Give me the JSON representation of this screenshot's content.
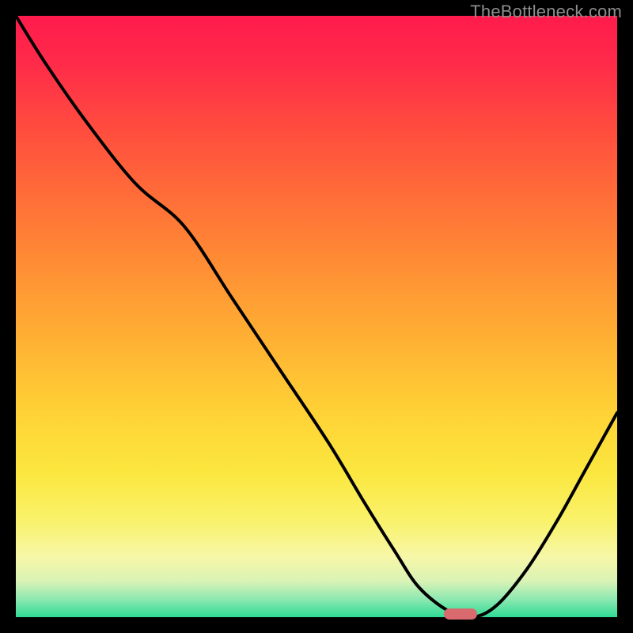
{
  "watermark": "TheBottleneck.com",
  "colors": {
    "frame": "#000000",
    "curve": "#000000",
    "marker": "#d96a6e",
    "watermark": "#8d8d8d"
  },
  "chart_data": {
    "type": "line",
    "title": "",
    "xlabel": "",
    "ylabel": "",
    "xlim": [
      0,
      100
    ],
    "ylim": [
      0,
      100
    ],
    "grid": false,
    "legend": false,
    "series": [
      {
        "name": "bottleneck-curve",
        "x": [
          0,
          5,
          12,
          20,
          28,
          36,
          44,
          52,
          58,
          63,
          67,
          72,
          76,
          80,
          85,
          90,
          95,
          100
        ],
        "y": [
          100,
          92,
          82,
          72,
          65,
          53,
          41,
          29,
          19,
          11,
          5,
          1,
          0,
          2,
          8,
          16,
          25,
          34
        ]
      }
    ],
    "annotations": [
      {
        "name": "optimal-marker",
        "x": 74,
        "y": 0.5,
        "shape": "pill"
      }
    ],
    "background_gradient_stops": [
      {
        "pct": 0,
        "color": "#ff1b4c"
      },
      {
        "pct": 8,
        "color": "#ff2b49"
      },
      {
        "pct": 18,
        "color": "#ff4a3f"
      },
      {
        "pct": 30,
        "color": "#ff6d38"
      },
      {
        "pct": 42,
        "color": "#ff8f34"
      },
      {
        "pct": 54,
        "color": "#ffb133"
      },
      {
        "pct": 66,
        "color": "#ffd235"
      },
      {
        "pct": 76,
        "color": "#fbe73f"
      },
      {
        "pct": 84,
        "color": "#f9f26b"
      },
      {
        "pct": 90,
        "color": "#f7f7a8"
      },
      {
        "pct": 94,
        "color": "#d9f3b5"
      },
      {
        "pct": 97,
        "color": "#8de8b1"
      },
      {
        "pct": 100,
        "color": "#2edb94"
      }
    ]
  }
}
